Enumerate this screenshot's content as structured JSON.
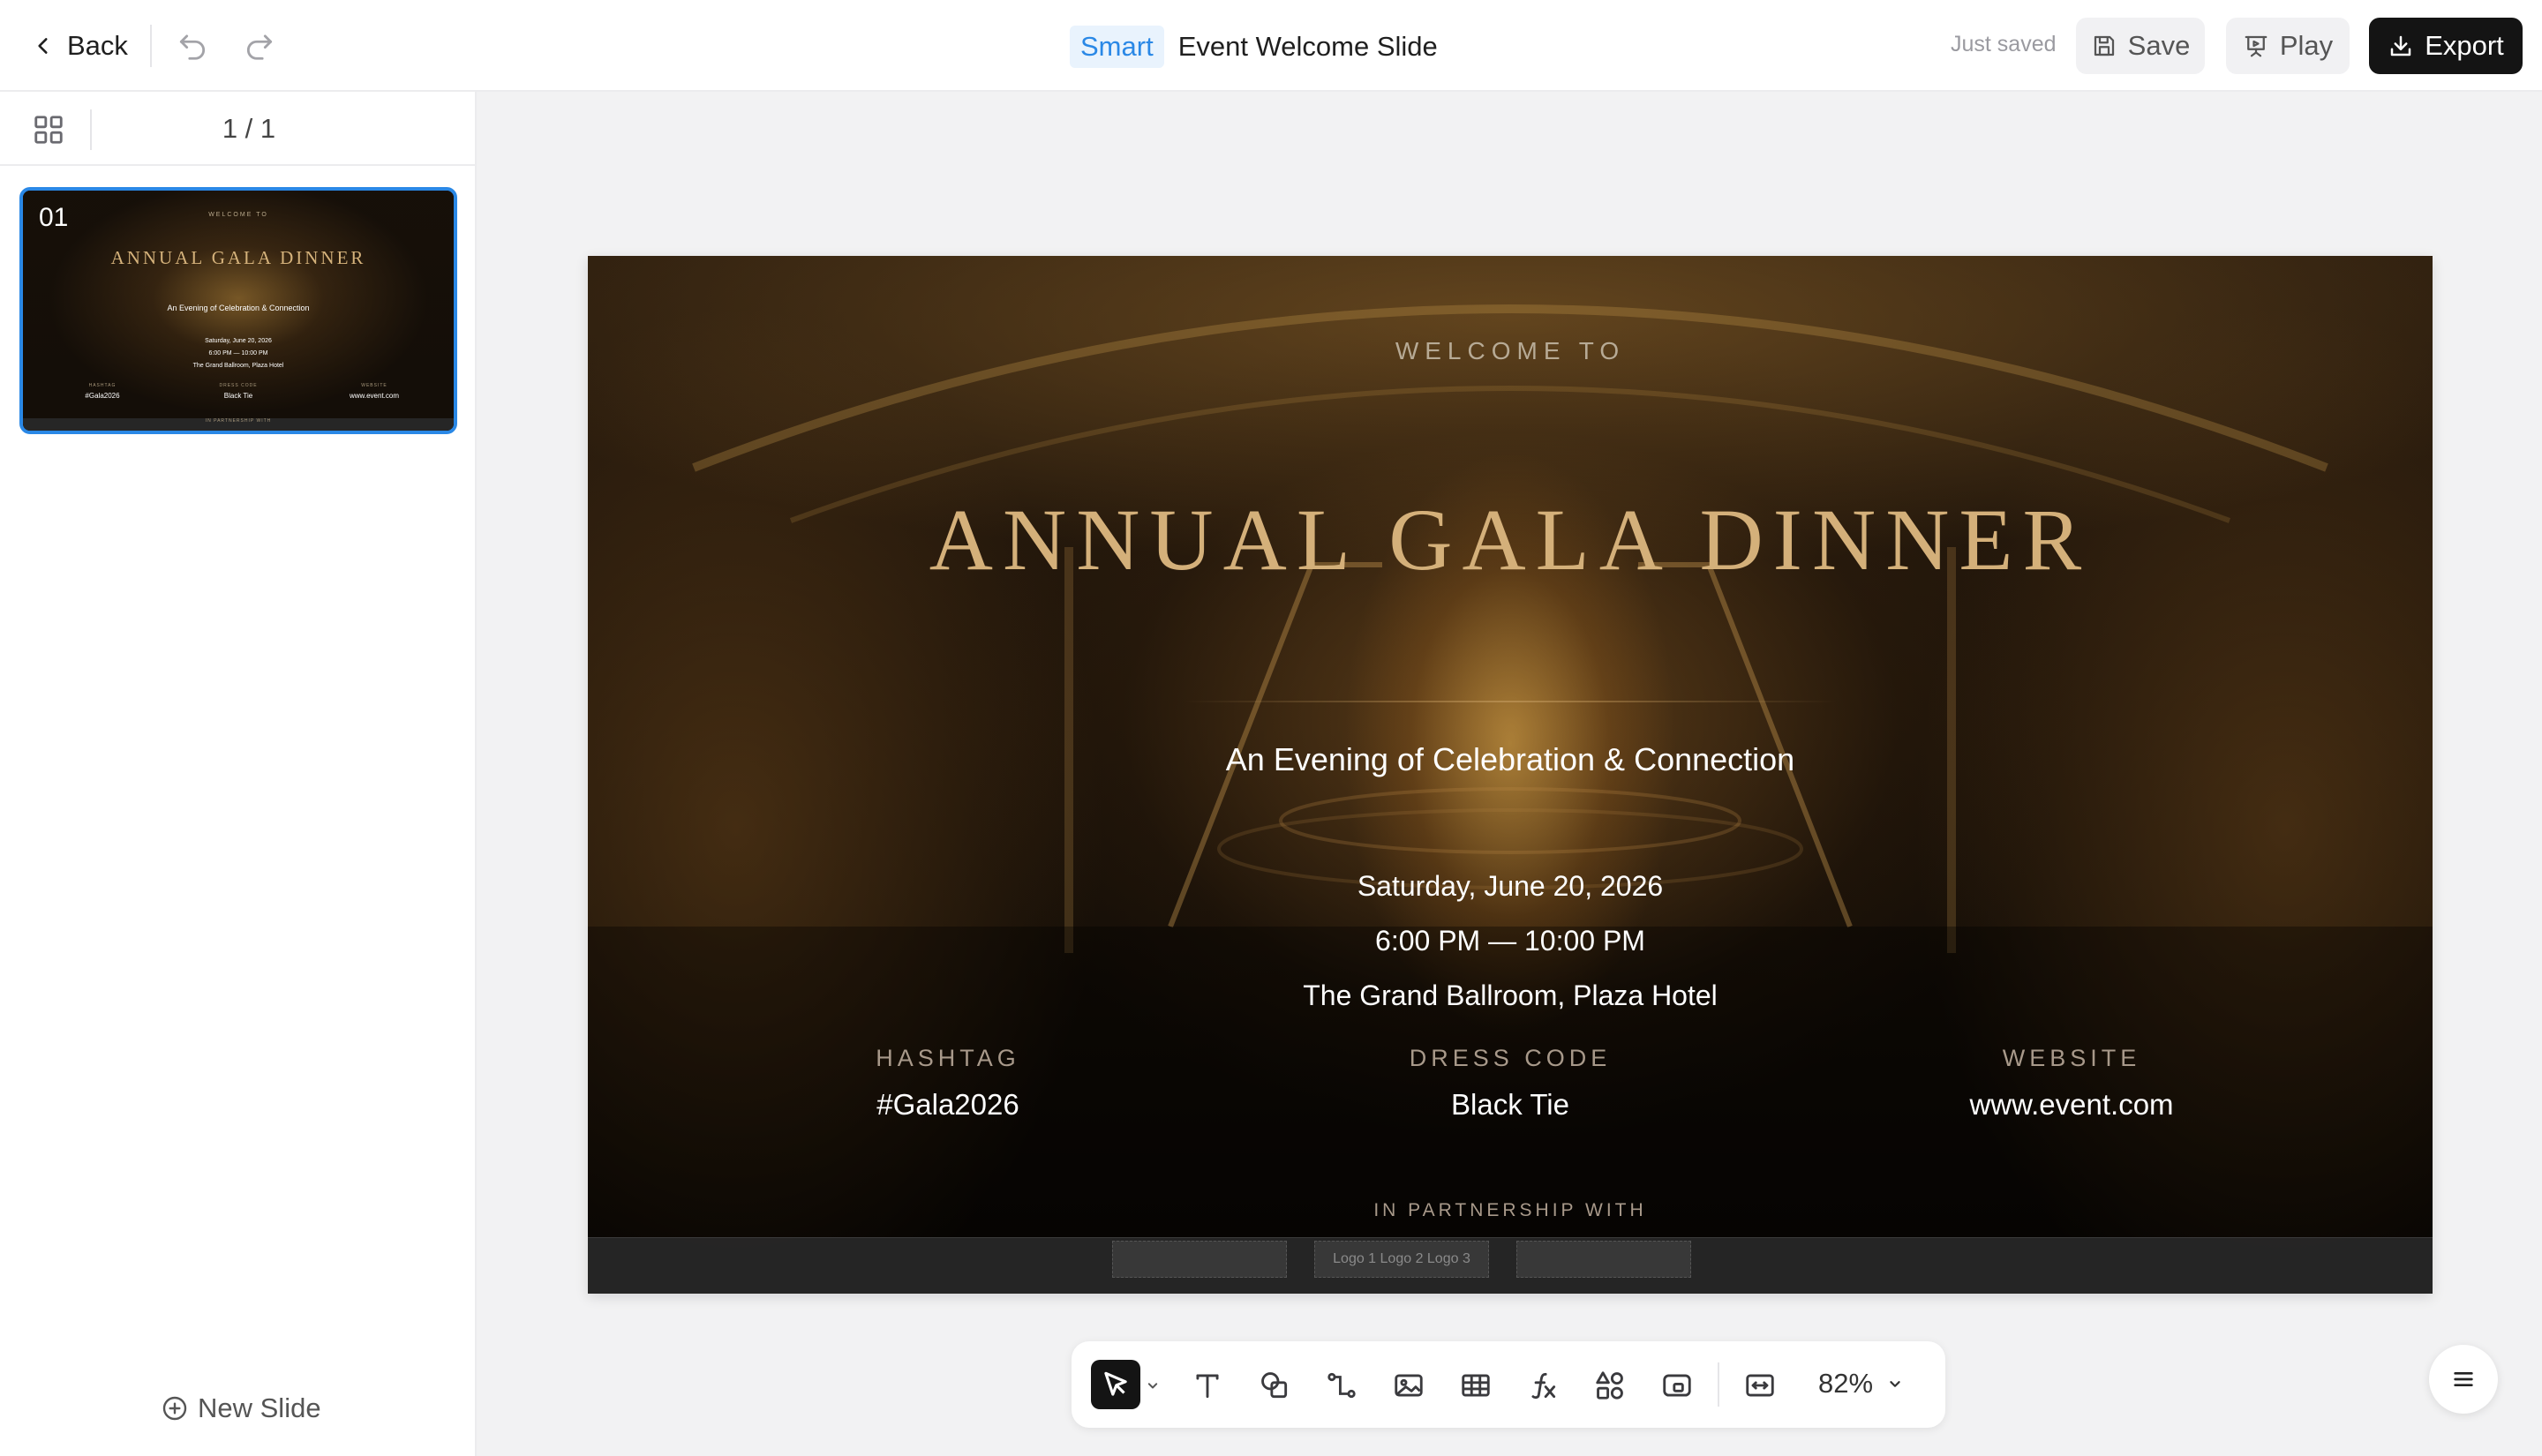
{
  "header": {
    "back_label": "Back",
    "badge": "Smart",
    "title": "Event Welcome Slide",
    "status": "Just saved",
    "save_label": "Save",
    "play_label": "Play",
    "export_label": "Export"
  },
  "sidebar": {
    "page_counter": "1 / 1",
    "new_slide_label": "New Slide",
    "slides": [
      {
        "number": "01",
        "selected": true
      }
    ]
  },
  "slide": {
    "welcome": "WELCOME TO",
    "title": "ANNUAL GALA DINNER",
    "subtitle": "An Evening of Celebration & Connection",
    "date": "Saturday, June 20, 2026",
    "time": "6:00 PM — 10:00 PM",
    "venue": "The Grand Ballroom, Plaza Hotel",
    "details": [
      {
        "label": "HASHTAG",
        "value": "#Gala2026"
      },
      {
        "label": "DRESS CODE",
        "value": "Black Tie"
      },
      {
        "label": "WEBSITE",
        "value": "www.event.com"
      }
    ],
    "partner_label": "IN PARTNERSHIP WITH",
    "logos_text": "Logo 1 Logo 2 Logo 3"
  },
  "toolbar": {
    "tools": [
      "select-icon",
      "text-icon",
      "shape-icon",
      "connector-icon",
      "image-icon",
      "table-icon",
      "formula-icon",
      "components-icon",
      "media-icon",
      "fit-icon"
    ],
    "zoom": "82%"
  },
  "colors": {
    "accent": "#2a88e6",
    "title_gold": "#d4b07a",
    "export_bg": "#141414"
  }
}
